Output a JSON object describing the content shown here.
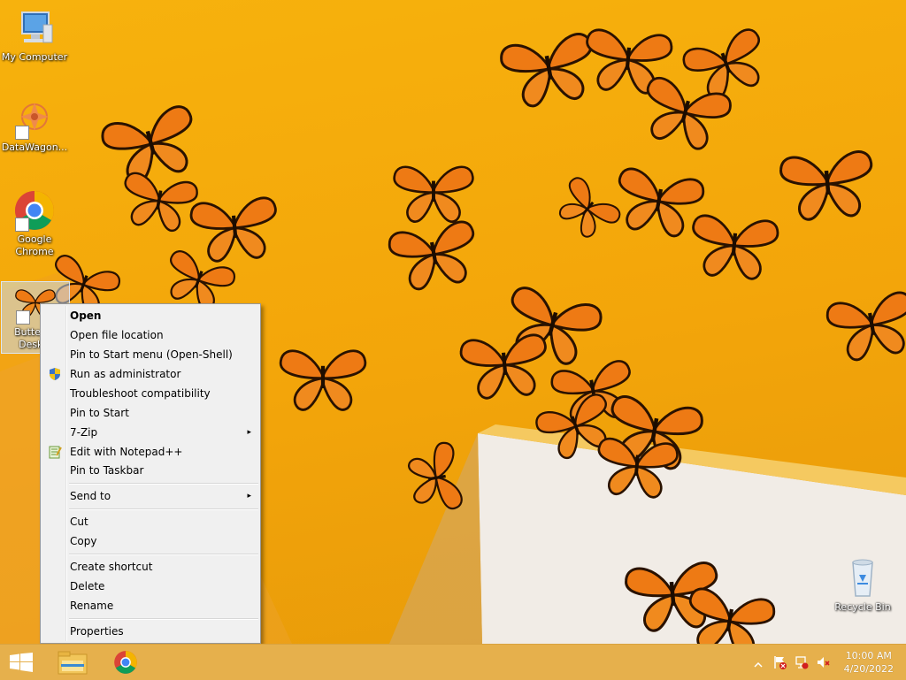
{
  "desktop": {
    "icons": [
      {
        "label": "My Computer"
      },
      {
        "label": "DataWagon..."
      },
      {
        "label": "Google Chrome"
      },
      {
        "label": "Butterfly Desk..."
      },
      {
        "label": "Recycle Bin"
      }
    ]
  },
  "context_menu": {
    "items": [
      {
        "label": "Open",
        "bold": true
      },
      {
        "label": "Open file location"
      },
      {
        "label": "Pin to Start menu (Open-Shell)"
      },
      {
        "label": "Run as administrator",
        "icon": "shield-icon"
      },
      {
        "label": "Troubleshoot compatibility"
      },
      {
        "label": "Pin to Start"
      },
      {
        "label": "7-Zip",
        "submenu": true
      },
      {
        "label": "Edit with Notepad++",
        "icon": "notepad-icon"
      },
      {
        "label": "Pin to Taskbar"
      },
      {
        "label": "Send to",
        "submenu": true
      },
      {
        "label": "Cut"
      },
      {
        "label": "Copy"
      },
      {
        "label": "Create shortcut"
      },
      {
        "label": "Delete"
      },
      {
        "label": "Rename"
      },
      {
        "label": "Properties"
      }
    ],
    "submenu_arrow": "▸"
  },
  "taskbar": {
    "pinned": [
      {
        "name": "file-explorer-icon"
      },
      {
        "name": "chrome-icon"
      }
    ],
    "clock": {
      "time": "10:00 AM",
      "date": "4/20/2022"
    }
  }
}
